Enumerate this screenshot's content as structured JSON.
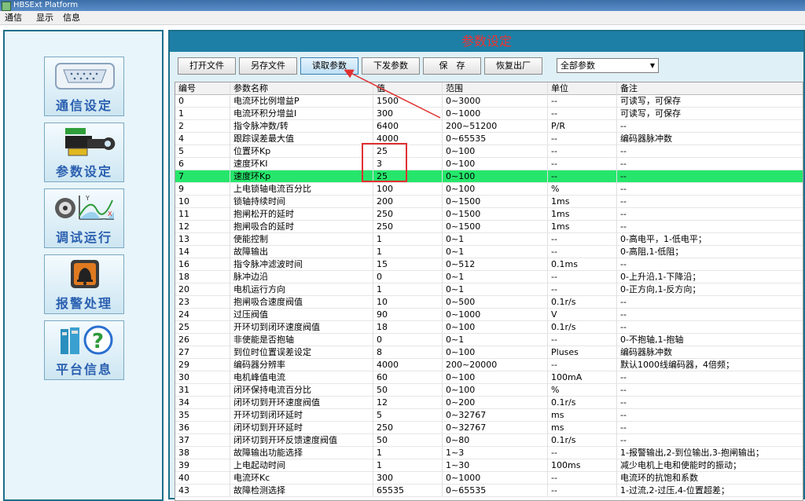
{
  "window": {
    "title": "HBSExt Platform"
  },
  "menu": [
    "通信",
    "显示",
    "信息"
  ],
  "sidebar": [
    {
      "label": "通信设定",
      "icon": "serial-port-icon"
    },
    {
      "label": "参数设定",
      "icon": "wrench-battery-icon"
    },
    {
      "label": "调试运行",
      "icon": "motor-chart-icon"
    },
    {
      "label": "报警处理",
      "icon": "alarm-bell-icon"
    },
    {
      "label": "平台信息",
      "icon": "help-info-icon"
    }
  ],
  "panel": {
    "title": "参数设定"
  },
  "toolbar": {
    "buttons": [
      "打开文件",
      "另存文件",
      "读取参数",
      "下发参数",
      "保　存",
      "恢复出厂"
    ],
    "filter": "全部参数"
  },
  "table": {
    "columns": [
      "编号",
      "参数名称",
      "值",
      "范围",
      "单位",
      "备注"
    ],
    "selected_index": 6,
    "rows": [
      [
        "0",
        "电流环比例增益P",
        "1500",
        "0~3000",
        "--",
        "可读写，可保存"
      ],
      [
        "1",
        "电流环积分增益I",
        "300",
        "0~1000",
        "--",
        "可读写，可保存"
      ],
      [
        "2",
        "指令脉冲数/转",
        "6400",
        "200~51200",
        "P/R",
        "--"
      ],
      [
        "4",
        "跟踪误差最大值",
        "4000",
        "0~65535",
        "--",
        "编码器脉冲数"
      ],
      [
        "5",
        "位置环Kp",
        "25",
        "0~100",
        "--",
        "--"
      ],
      [
        "6",
        "速度环KI",
        "3",
        "0~100",
        "--",
        "--"
      ],
      [
        "7",
        "速度环Kp",
        "25",
        "0~100",
        "--",
        "--"
      ],
      [
        "9",
        "上电锁轴电流百分比",
        "100",
        "0~100",
        "%",
        "--"
      ],
      [
        "10",
        "锁轴持续时间",
        "200",
        "0~1500",
        "1ms",
        "--"
      ],
      [
        "11",
        "抱闸松开的延时",
        "250",
        "0~1500",
        "1ms",
        "--"
      ],
      [
        "12",
        "抱闸吸合的延时",
        "250",
        "0~1500",
        "1ms",
        "--"
      ],
      [
        "13",
        "使能控制",
        "1",
        "0~1",
        "--",
        "0-高电平，1-低电平；"
      ],
      [
        "14",
        "故障输出",
        "1",
        "0~1",
        "--",
        "0-高阻,1-低阻；"
      ],
      [
        "16",
        "指令脉冲滤波时间",
        "15",
        "0~512",
        "0.1ms",
        "--"
      ],
      [
        "18",
        "脉冲边沿",
        "0",
        "0~1",
        "--",
        "0-上升沿,1-下降沿；"
      ],
      [
        "20",
        "电机运行方向",
        "1",
        "0~1",
        "--",
        "0-正方向,1-反方向；"
      ],
      [
        "23",
        "抱闸吸合速度阀值",
        "10",
        "0~500",
        "0.1r/s",
        "--"
      ],
      [
        "24",
        "过压阀值",
        "90",
        "0~1000",
        "V",
        "--"
      ],
      [
        "25",
        "开环切到闭环速度阀值",
        "18",
        "0~100",
        "0.1r/s",
        "--"
      ],
      [
        "26",
        "非使能是否抱轴",
        "0",
        "0~1",
        "--",
        "0-不抱轴,1-抱轴"
      ],
      [
        "27",
        "到位时位置误差设定",
        "8",
        "0~100",
        "Pluses",
        "编码器脉冲数"
      ],
      [
        "29",
        "编码器分辨率",
        "4000",
        "200~20000",
        "--",
        "默认1000线编码器，4倍频；"
      ],
      [
        "30",
        "电机峰值电流",
        "60",
        "0~100",
        "100mA",
        "--"
      ],
      [
        "31",
        "闭环保持电流百分比",
        "50",
        "0~100",
        "%",
        "--"
      ],
      [
        "34",
        "闭环切到开环速度阀值",
        "12",
        "0~200",
        "0.1r/s",
        "--"
      ],
      [
        "35",
        "开环切到闭环延时",
        "5",
        "0~32767",
        "ms",
        "--"
      ],
      [
        "36",
        "闭环切到开环延时",
        "250",
        "0~32767",
        "ms",
        "--"
      ],
      [
        "37",
        "闭环切到开环反馈速度阀值",
        "50",
        "0~80",
        "0.1r/s",
        "--"
      ],
      [
        "38",
        "故障输出功能选择",
        "1",
        "1~3",
        "--",
        "1-报警输出,2-到位输出,3-抱闸输出；"
      ],
      [
        "39",
        "上电起动时间",
        "1",
        "1~30",
        "100ms",
        "减少电机上电和使能时的振动；"
      ],
      [
        "40",
        "电流环Kc",
        "300",
        "0~1000",
        "--",
        "电流环的抗饱和系数"
      ],
      [
        "43",
        "故障检测选择",
        "65535",
        "0~65535",
        "--",
        "1-过流,2-过压,4-位置超差；"
      ]
    ]
  },
  "colors": {
    "accent": "#1e7fa6",
    "selected_row": "#25e66b",
    "annotation": "#e03030"
  }
}
